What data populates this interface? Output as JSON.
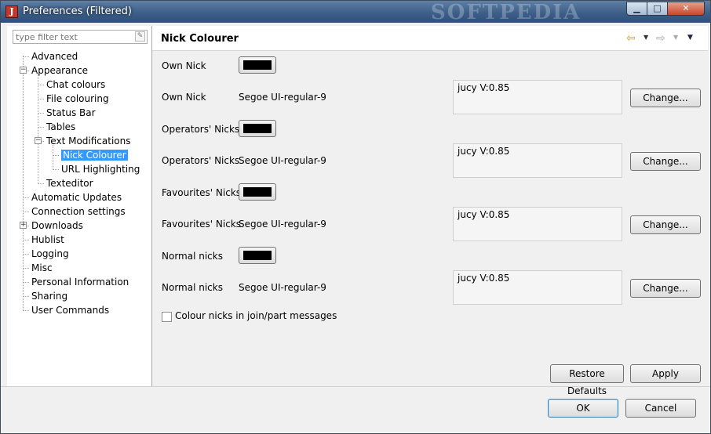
{
  "window": {
    "title": "Preferences (Filtered)",
    "watermark": "SOFTPEDIA"
  },
  "titlebar_buttons": {
    "minimize": "▁",
    "maximize": "□",
    "close": "✕"
  },
  "filter": {
    "placeholder": "type filter text",
    "clear_icon": "✎"
  },
  "tree": [
    {
      "label": "Advanced"
    },
    {
      "label": "Appearance",
      "expanded": true
    },
    {
      "label": "Chat colours"
    },
    {
      "label": "File colouring"
    },
    {
      "label": "Status Bar"
    },
    {
      "label": "Tables"
    },
    {
      "label": "Text Modifications",
      "expanded": true
    },
    {
      "label": "Nick Colourer",
      "selected": true
    },
    {
      "label": "URL Highlighting"
    },
    {
      "label": "Texteditor"
    },
    {
      "label": "Automatic Updates"
    },
    {
      "label": "Connection settings"
    },
    {
      "label": "Downloads",
      "collapsed": true
    },
    {
      "label": "Hublist"
    },
    {
      "label": "Logging"
    },
    {
      "label": "Misc"
    },
    {
      "label": "Personal Information"
    },
    {
      "label": "Sharing"
    },
    {
      "label": "User Commands"
    }
  ],
  "page": {
    "title": "Nick Colourer",
    "back_icon": "⇦",
    "forward_icon": "⇨",
    "menu_icon": "▼"
  },
  "rows": [
    {
      "color_label": "Own Nick",
      "font_label": "Own Nick",
      "font": "Segoe UI-regular-9",
      "preview": "jucy V:0.85",
      "swatch": "#000000"
    },
    {
      "color_label": "Operators' Nicks",
      "font_label": "Operators' Nicks",
      "font": "Segoe UI-regular-9",
      "preview": "jucy V:0.85",
      "swatch": "#000000"
    },
    {
      "color_label": "Favourites' Nicks",
      "font_label": "Favourites' Nicks",
      "font": "Segoe UI-regular-9",
      "preview": "jucy V:0.85",
      "swatch": "#000000"
    },
    {
      "color_label": "Normal nicks",
      "font_label": "Normal nicks",
      "font": "Segoe UI-regular-9",
      "preview": "jucy V:0.85",
      "swatch": "#000000"
    }
  ],
  "change_label": "Change...",
  "checkbox": {
    "label": "Colour nicks in join/part messages",
    "checked": false
  },
  "buttons": {
    "restore": "Restore Defaults",
    "apply": "Apply",
    "ok": "OK",
    "cancel": "Cancel"
  }
}
